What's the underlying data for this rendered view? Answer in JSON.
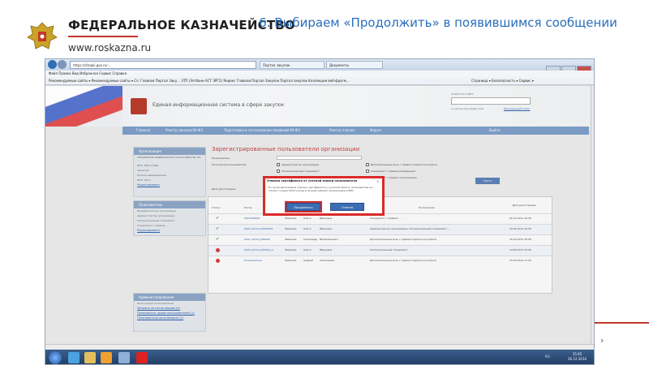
{
  "header": {
    "brand": "ФЕДЕРАЛЬНОЕ КАЗНАЧЕЙСТВО",
    "url": "www.roskazna.ru",
    "slide_title": "6. Выбираем «Продолжить» в появившимся сообщении"
  },
  "browser": {
    "address": "https://sitepki.gov.ru/...",
    "tabs": [
      "Портал закупок",
      "Документы"
    ],
    "menu": "Файл  Правка  Вид  Избранное  Сервис  Справка",
    "favorites": "Рекомендуемые сайты ▾   Рекомендуемые сайты ▾   Сл. Главная Портал Заку...   ЭТП (Ээтбанк-АСТ ЭРГ2)   Яндекс   Главная Портал Закупок   Портал закупок   Коллекция веб-фрагм...",
    "tools": "Страница ▾  Безопасность ▾  Сервис ▾"
  },
  "site": {
    "title": "Единая информационная система в сфере закупок",
    "search_label": "ПОИСК ПО САЙТУ",
    "search_option": "С учетом всех форм слов",
    "search_ext": "Расширенный поиск",
    "nav": [
      "Главная",
      "Реестр заказов 94-ФЗ",
      "Подготовка и согласование сведений 94-ФЗ",
      "Реестр планов",
      "Форум",
      "Выйти"
    ]
  },
  "sidebar": {
    "org_head": "Организация",
    "org_lines": [
      "УПРАВЛЕНИЕ ФЕДЕРАЛЬНОГО КАЗНАЧЕЙСТВА ПО ...",
      "ИНН: 0811 (ОКД)",
      "Заказчик",
      "Полное наименование ...",
      "ИНН: 4273 ..."
    ],
    "org_link": "Редактировать",
    "user_head": "Пользователь",
    "user_lines": [
      "Входящие блоки организации",
      "Администратор организации",
      "Уполномоченный специалист",
      "Специалист с правом ..."
    ],
    "user_link": "Редактировать",
    "admin_head": "Администрирование",
    "admin_lines": [
      "Регистрация пользователей",
      "Запросы на регистрацию (0)",
      "Полномочия, права пользователей (1)",
      "Пользователи организации (1)"
    ]
  },
  "content": {
    "title": "Зарегистрированные пользователи организации",
    "labels": [
      "Пользователь:",
      "Полномочия пользователя:",
      "Дата регистрации:"
    ],
    "checks": [
      "Администратор организации",
      "Уполномоченный специалист",
      "Дополнительная роль с правом подписи контракта",
      "Специалист с правом размещения",
      "Специалист с правом согласования"
    ],
    "search_btn": "Найти",
    "count_label": "Найдено: 5",
    "columns": [
      "Статус",
      "Логин",
      "Фамилия",
      "Имя",
      "Отчество",
      "Полномочия",
      "Дата регистрации"
    ],
    "rows": [
      {
        "status": "ok",
        "login": "0421299994",
        "last": "Фамилия",
        "first": "Ольга",
        "middle": "Ивановна",
        "role": "Специалист с правом ...",
        "date": "02.12.2011 10:30"
      },
      {
        "status": "ok",
        "login": "0421_02110_00000001",
        "last": "Фамилия",
        "first": "Ольга",
        "middle": "Ивановна",
        "role": "Администратор организации, Уполномоченный специалист ...",
        "date": "19.01.2012 15:50"
      },
      {
        "status": "ok",
        "login": "0421_02110_000000",
        "last": "Фамилия",
        "first": "Александр",
        "middle": "Валентинович",
        "role": "Дополнительная роль с правом подписи контракта",
        "date": "15.12.2013 15:00"
      },
      {
        "status": "no",
        "login": "0421_02110_000000_rs",
        "last": "Фамилия",
        "first": "Ольга",
        "middle": "Ивановна",
        "role": "Уполномоченный специалист",
        "date": "14.09.2013 15:00"
      },
      {
        "status": "no",
        "login": "Пользователь",
        "last": "Фамилия",
        "first": "Андрей",
        "middle": "Алексеевич",
        "role": "Дополнительная роль с правом подписи контракта",
        "date": "15.03.2014 17:50"
      }
    ]
  },
  "dialog": {
    "title": "Отвязка сертификата от учетной записи пользователя",
    "body": "В случае выполнения отвязки сертификата от учетной записи, пользователь не сможет осуществлять вход в личный кабинет организации в ЕИС.",
    "continue": "Продолжить",
    "cancel": "Отмена"
  },
  "taskbar": {
    "time": "15:45",
    "date": "26.12.2014",
    "tray": "RU"
  }
}
